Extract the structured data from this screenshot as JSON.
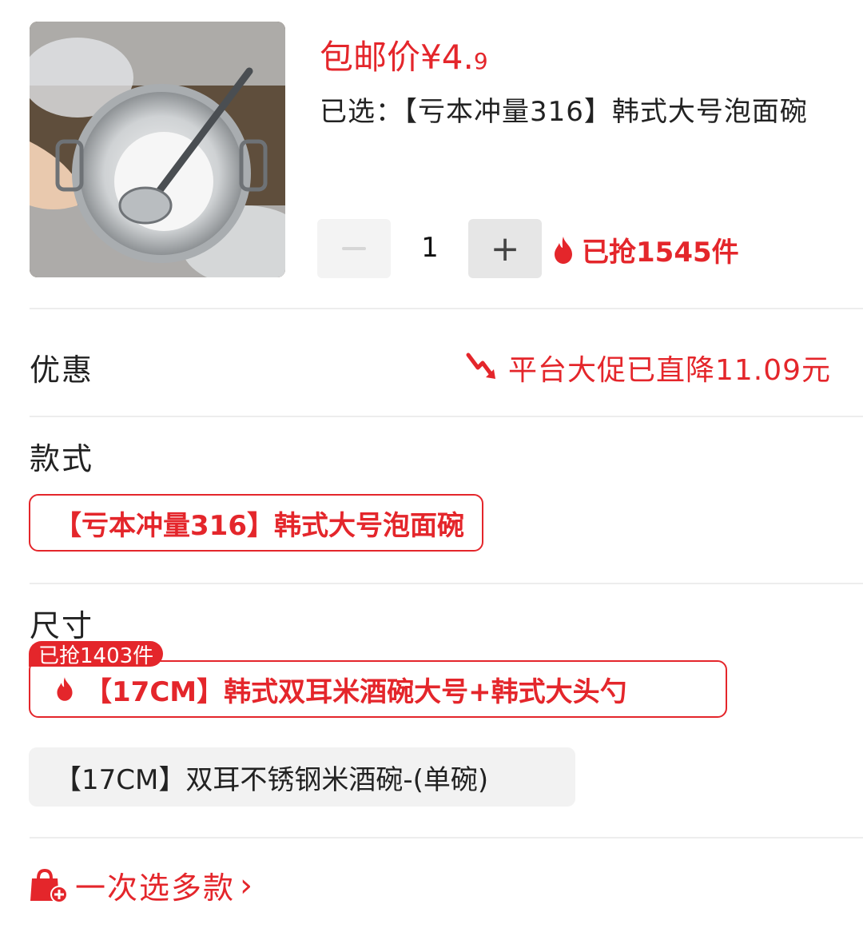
{
  "product": {
    "price_label": "包邮价",
    "price_symbol": "¥",
    "price_int": "4.",
    "price_dec": "9",
    "selected_text": "已选：【亏本冲量316】韩式大号泡面碗"
  },
  "quantity": {
    "value": "1",
    "minus_label": "−",
    "plus_label": "+"
  },
  "sold": {
    "text": "已抢1545件"
  },
  "discount": {
    "title": "优惠",
    "promo_text": "平台大促已直降11.09元"
  },
  "style": {
    "title": "款式",
    "options": [
      {
        "label": "【亏本冲量316】韩式大号泡面碗",
        "selected": true
      }
    ]
  },
  "size": {
    "title": "尺寸",
    "badge": "已抢1403件",
    "options": [
      {
        "label": "【17CM】韩式双耳米酒碗大号+韩式大头勺",
        "selected": true
      },
      {
        "label": "【17CM】双耳不锈钢米酒碗-(单碗)",
        "selected": false
      }
    ]
  },
  "multi_select": {
    "label": "一次选多款",
    "chevron": "›"
  },
  "colors": {
    "accent": "#e4262b",
    "divider": "#ededed",
    "chip_bg": "#f2f2f2"
  },
  "icons": [
    "fire-icon",
    "down-trend-icon",
    "shopping-bag-plus-icon",
    "chevron-right-icon"
  ]
}
